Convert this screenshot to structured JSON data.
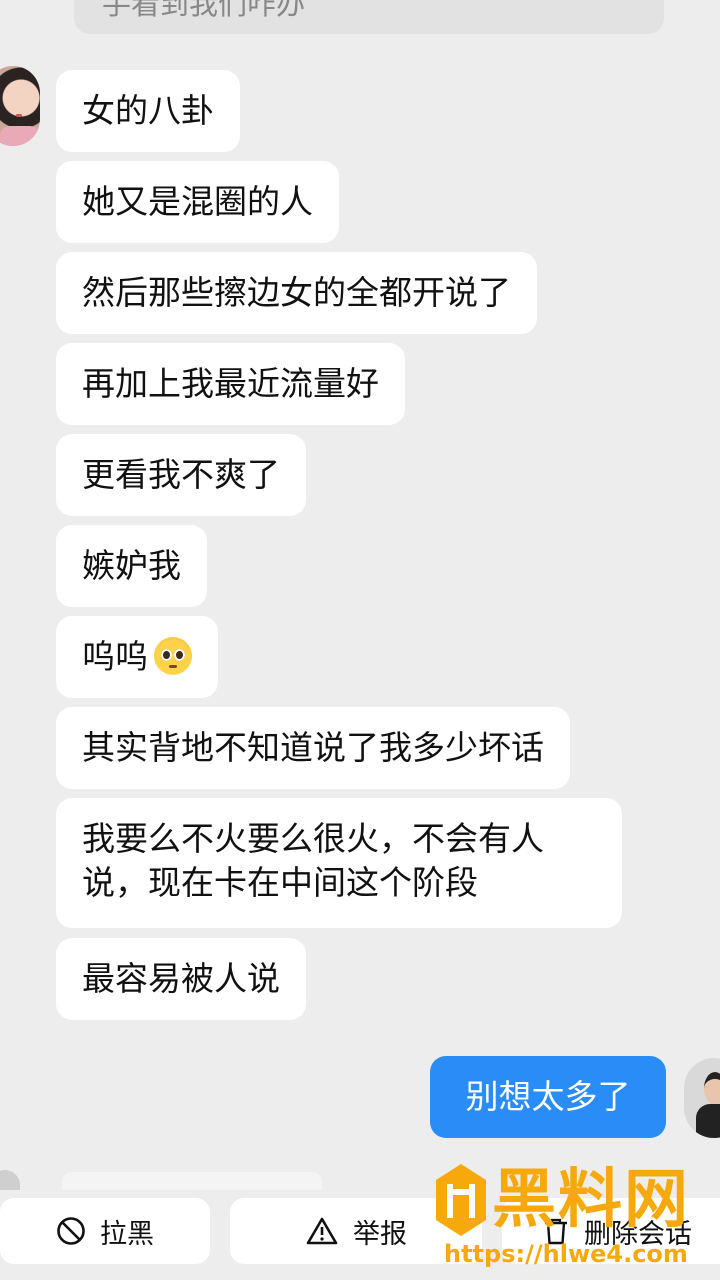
{
  "top_partial_message": "手看到我们咋办",
  "messages": [
    {
      "text": "女的八卦"
    },
    {
      "text": "她又是混圈的人"
    },
    {
      "text": "然后那些擦边女的全都开说了"
    },
    {
      "text": "再加上我最近流量好"
    },
    {
      "text": "更看我不爽了"
    },
    {
      "text": "嫉妒我"
    },
    {
      "text": "呜呜",
      "emoji": "pleading-face-emoji"
    },
    {
      "text": "其实背地不知道说了我多少坏话"
    },
    {
      "text": "我要么不火要么很火，不会有人说，现在卡在中间这个阶段"
    },
    {
      "text": "最容易被人说"
    }
  ],
  "self_message": {
    "text": "别想太多了",
    "color": "#2a8cf7"
  },
  "actions": {
    "block": {
      "label": "拉黑",
      "icon": "ban-icon"
    },
    "report": {
      "label": "举报",
      "icon": "warning-icon"
    },
    "delete": {
      "label": "删除会话",
      "icon": "trash-icon"
    }
  },
  "watermark": {
    "brand": "黑料网",
    "url": "https://hlwe4.com",
    "color": "#f7a90b"
  }
}
